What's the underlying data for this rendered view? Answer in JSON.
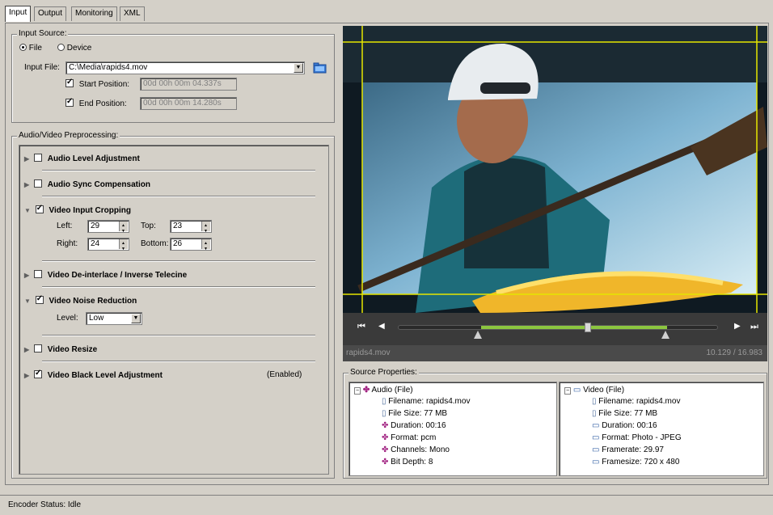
{
  "tabs": [
    "Input",
    "Output",
    "Monitoring",
    "XML"
  ],
  "input_source": {
    "title": "Input Source:",
    "file_label": "File",
    "device_label": "Device",
    "input_file_label": "Input File:",
    "input_file_value": "C:\\Media\\rapids4.mov",
    "start_label": "Start Position:",
    "start_value": "00d 00h 00m 04.337s",
    "end_label": "End Position:",
    "end_value": "00d 00h 00m 14.280s"
  },
  "preprocessing": {
    "title": "Audio/Video Preprocessing:",
    "audio_level": "Audio Level Adjustment",
    "audio_sync": "Audio Sync Compensation",
    "crop": "Video Input Cropping",
    "left_label": "Left:",
    "left_value": "29",
    "top_label": "Top:",
    "top_value": "23",
    "right_label": "Right:",
    "right_value": "24",
    "bottom_label": "Bottom:",
    "bottom_value": "26",
    "deinterlace": "Video De-interlace / Inverse Telecine",
    "noise": "Video Noise Reduction",
    "level_label": "Level:",
    "level_value": "Low",
    "resize": "Video Resize",
    "black_level": "Video Black Level  Adjustment",
    "black_level_status": "(Enabled)"
  },
  "player": {
    "filename": "rapids4.mov",
    "time": "10.129 / 16.983",
    "progress": 0.58
  },
  "source_properties": {
    "title": "Source Properties:",
    "audio": {
      "header": "Audio (File)",
      "items": [
        "Filename: rapids4.mov",
        "File Size: 77 MB",
        "Duration: 00:16",
        "Format: pcm",
        "Channels: Mono",
        "Bit Depth: 8"
      ]
    },
    "video": {
      "header": "Video (File)",
      "items": [
        "Filename: rapids4.mov",
        "File Size: 77 MB",
        "Duration: 00:16",
        "Format: Photo - JPEG",
        "Framerate: 29.97",
        "Framesize: 720 x 480"
      ]
    }
  },
  "status": "Encoder Status: Idle"
}
